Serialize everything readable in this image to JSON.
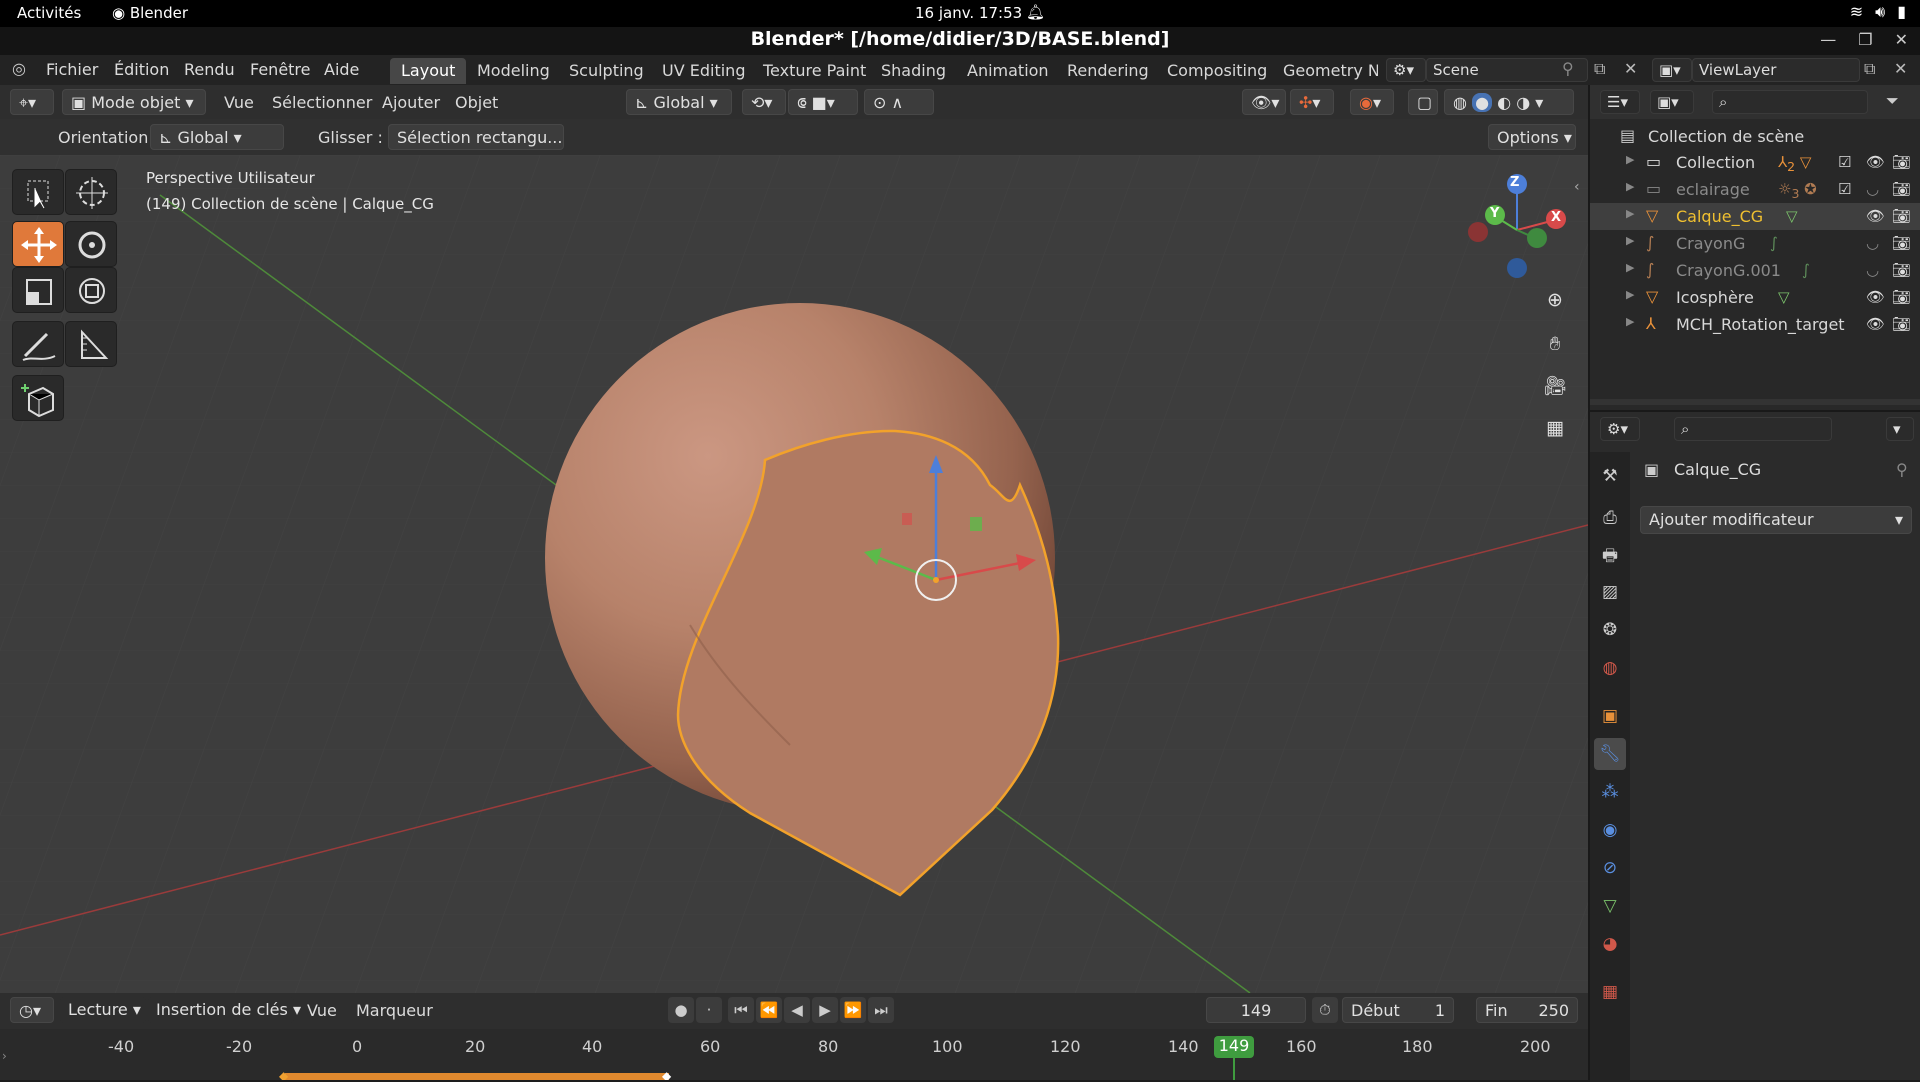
{
  "system": {
    "activities": "Activités",
    "app_name": "Blender",
    "clock": "16 janv.  17:53"
  },
  "window": {
    "title": "Blender* [/home/didier/3D/BASE.blend]"
  },
  "menus": [
    "Fichier",
    "Édition",
    "Rendu",
    "Fenêtre",
    "Aide"
  ],
  "workspaces": [
    {
      "label": "Layout",
      "active": true
    },
    {
      "label": "Modeling"
    },
    {
      "label": "Sculpting"
    },
    {
      "label": "UV Editing"
    },
    {
      "label": "Texture Paint"
    },
    {
      "label": "Shading"
    },
    {
      "label": "Animation"
    },
    {
      "label": "Rendering"
    },
    {
      "label": "Compositing"
    },
    {
      "label": "Geometry Nc"
    }
  ],
  "scene": {
    "name": "Scene",
    "view_layer": "ViewLayer"
  },
  "viewport_header": {
    "mode": "Mode objet",
    "menus": [
      "Vue",
      "Sélectionner",
      "Ajouter",
      "Objet"
    ],
    "transform_orientation": "Global"
  },
  "tool_settings": {
    "orientation_label": "Orientation:",
    "orientation_value": "Global",
    "drag_label": "Glisser :",
    "drag_value": "Sélection rectangu...",
    "options": "Options"
  },
  "viewport": {
    "view_name": "Perspective Utilisateur",
    "view_info": "(149) Collection de scène | Calque_CG",
    "gizmo": {
      "x": "X",
      "y": "Y",
      "z": "Z"
    }
  },
  "outliner": {
    "root": "Collection de scène",
    "items": [
      {
        "name": "Collection",
        "icon": "collection-icon",
        "badge": "2"
      },
      {
        "name": "eclairage",
        "icon": "collection-icon",
        "badge": "3"
      },
      {
        "name": "Calque_CG",
        "icon": "mesh-object-icon",
        "selected": true
      },
      {
        "name": "CrayonG",
        "icon": "grease-pencil-icon"
      },
      {
        "name": "CrayonG.001",
        "icon": "grease-pencil-icon"
      },
      {
        "name": "Icosphère",
        "icon": "mesh-object-icon"
      },
      {
        "name": "MCH_Rotation_target",
        "icon": "empty-icon"
      }
    ]
  },
  "properties": {
    "object_name": "Calque_CG",
    "add_modifier": "Ajouter modificateur"
  },
  "timeline": {
    "playback": "Lecture",
    "keying": "Insertion de clés",
    "view": "Vue",
    "marker": "Marqueur",
    "current_frame": "149",
    "start_label": "Début",
    "start": "1",
    "end_label": "Fin",
    "end": "250",
    "ticks": [
      "-40",
      "-20",
      "0",
      "20",
      "40",
      "60",
      "80",
      "100",
      "120",
      "140",
      "160",
      "180",
      "200"
    ],
    "playhead_label": "149"
  },
  "colors": {
    "accent": "#4772b3",
    "selection_orange": "#f2a22b",
    "playhead_green": "#3f9c3f",
    "sphere": "#b7826a"
  }
}
